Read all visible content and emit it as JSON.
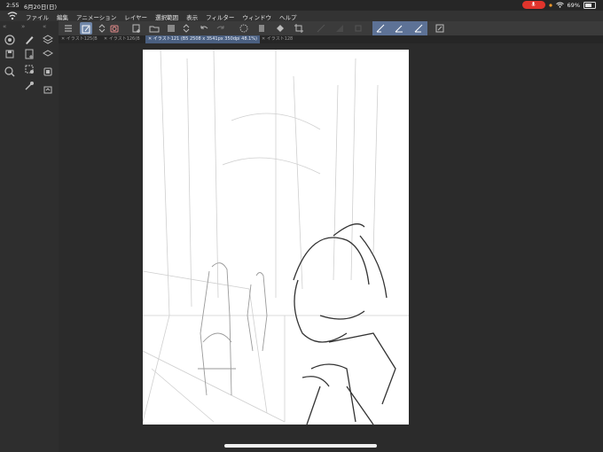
{
  "status_bar": {
    "time": "2:55",
    "date": "6月20日(日)",
    "battery_percent": "69%",
    "battery_level": 0.69
  },
  "menu": {
    "items": [
      "ファイル",
      "編集",
      "アニメーション",
      "レイヤー",
      "選択範囲",
      "表示",
      "フィルター",
      "ウィンドウ",
      "ヘルプ"
    ]
  },
  "tabs": [
    {
      "label": "イラスト125(B",
      "active": false
    },
    {
      "label": "イラスト126(B",
      "active": false
    },
    {
      "label": "イラスト121 (B5 2508 x 3541px 350dpi 48.1%)",
      "active": true
    },
    {
      "label": "イラスト128",
      "active": false
    }
  ],
  "colors": {
    "accent": "#5d7296",
    "mic_indicator": "#e0342c",
    "canvas": "#ffffff",
    "background": "#2b2b2b"
  },
  "icons": {
    "sidebar": [
      "brush-size-icon",
      "pen-tool-icon",
      "layer-stack-icon",
      "save-icon",
      "new-file-icon",
      "layers-icon",
      "zoom-icon",
      "transform-icon",
      "dropper-icon",
      "navigator-icon",
      "material-icon"
    ],
    "toolbar": [
      "menu-icon",
      "edit-icon",
      "stepper-icon",
      "camera-icon",
      "new-canvas-icon",
      "open-icon",
      "folder-stepper-icon",
      "undo-icon",
      "redo-icon",
      "select-icon",
      "clipboard-icon",
      "fill-icon",
      "crop-icon",
      "disabled-1-icon",
      "disabled-2-icon",
      "disabled-3-icon",
      "ruler-icon",
      "pen-a-icon",
      "pen-b-icon",
      "pen-c-icon",
      "quick-access-icon"
    ]
  }
}
